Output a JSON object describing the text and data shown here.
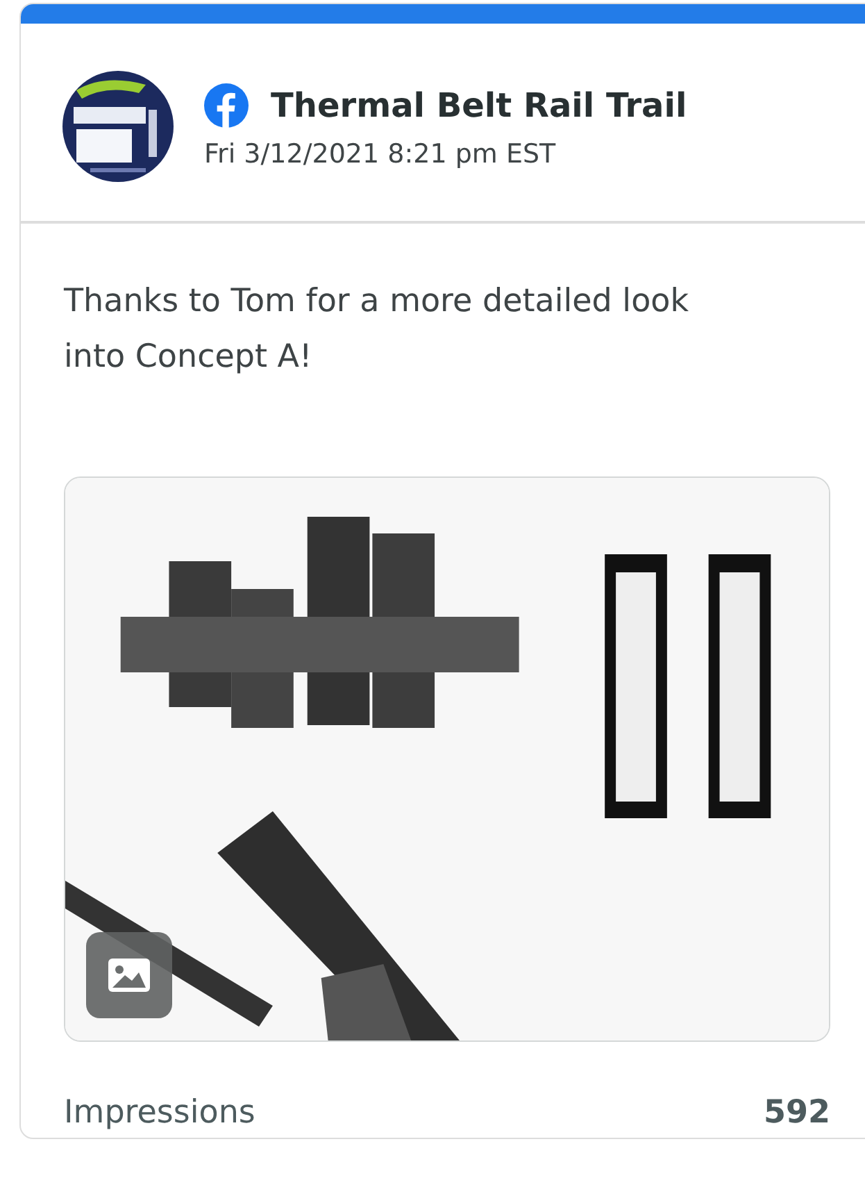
{
  "post": {
    "author": "Thermal Belt Rail Trail",
    "date": "Fri 3/12/2021 8:21 pm EST",
    "text": "Thanks to Tom for a more detailed look into Concept A!"
  },
  "stats": [
    {
      "label": "Impressions",
      "value": "592"
    }
  ]
}
